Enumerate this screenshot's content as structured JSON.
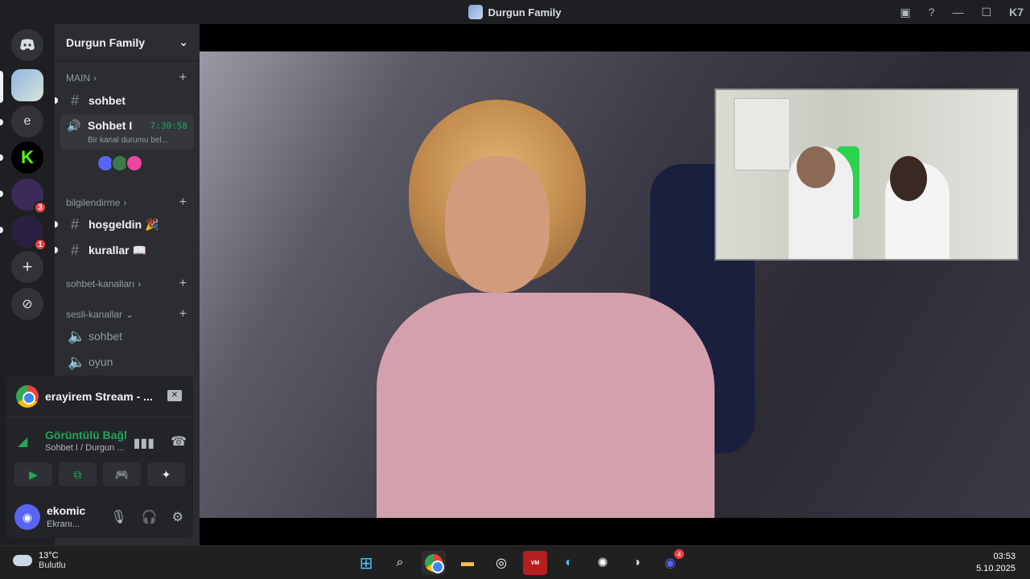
{
  "window": {
    "title": "Durgun Family",
    "help": "?",
    "minimize": "—",
    "maximize": "☐",
    "close": "✕",
    "kick_badge": "K7"
  },
  "servers": [
    {
      "name": "discord-home",
      "glyph": "◉"
    },
    {
      "name": "durgun-family",
      "glyph": ""
    },
    {
      "name": "server-e",
      "glyph": "e"
    },
    {
      "name": "kick-server",
      "glyph": "K"
    },
    {
      "name": "server-4",
      "glyph": "",
      "badge": "3"
    },
    {
      "name": "server-5",
      "glyph": "",
      "badge": "1"
    },
    {
      "name": "add-server",
      "glyph": "+"
    },
    {
      "name": "discover",
      "glyph": "⊘"
    }
  ],
  "guild": {
    "name": "Durgun Family",
    "chevron": "⌄"
  },
  "categories": {
    "main": "MAIN",
    "bilgilendirme": "bilgilendirme",
    "sohbet_kanallari": "sohbet-kanalları",
    "sesli_kanallar": "sesli-kanallar"
  },
  "channels": {
    "sohbet": "sohbet",
    "voice_active_name": "Sohbet I",
    "voice_active_time": "7:30:58",
    "voice_active_status": "Bir kanal durumu bel...",
    "hosgeldin": "hoşgeldin 🎉",
    "kurallar": "kurallar 📖",
    "voice_sohbet": "sohbet",
    "voice_oyun": "oyun"
  },
  "stream": {
    "name": "erayirem Stream - ..."
  },
  "connection": {
    "status": "Görüntülü Bağl",
    "channel": "Sohbet I / Durgun ..."
  },
  "user": {
    "name": "ekomic",
    "status": "Ekranı..."
  },
  "taskbar": {
    "temperature": "13°C",
    "weather": "Bulutlu",
    "time": "03:53",
    "date": "5.10.2025",
    "discord_badge": "4"
  },
  "colors": {
    "accent": "#5865f2",
    "online": "#23a55a",
    "danger": "#f23f43",
    "kick": "#53fc18"
  }
}
